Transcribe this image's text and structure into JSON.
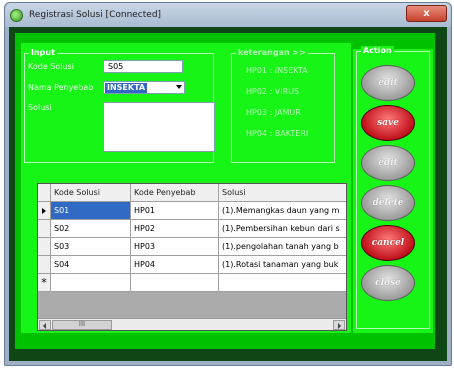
{
  "window": {
    "title": "Registrasi Solusi [Connected]",
    "close_label": "x"
  },
  "input_group": {
    "legend": "Input",
    "kode_solusi_label": "Kode Solusi",
    "kode_solusi_value": "S05",
    "nama_penyebab_label": "Nama Penyebab",
    "nama_penyebab_value": "INSEKTA",
    "solusi_label": "Solusi",
    "solusi_value": ""
  },
  "keterangan": {
    "legend": "keterangan >>",
    "items": [
      "HP01 : INSEKTA",
      "HP02 : VIRUS",
      "HP03 : JAMUR",
      "HP04 : BAKTERI"
    ]
  },
  "action": {
    "legend": "Action",
    "buttons": [
      {
        "label": "edit",
        "color": "grey"
      },
      {
        "label": "save",
        "color": "red"
      },
      {
        "label": "edit",
        "color": "grey"
      },
      {
        "label": "delete",
        "color": "grey"
      },
      {
        "label": "cancel",
        "color": "red"
      },
      {
        "label": "close",
        "color": "grey"
      }
    ]
  },
  "grid": {
    "columns": [
      "Kode Solusi",
      "Kode Penyebab",
      "Solusi"
    ],
    "rows": [
      {
        "kode_solusi": "S01",
        "kode_penyebab": "HP01",
        "solusi": "(1).Memangkas daun yang m"
      },
      {
        "kode_solusi": "S02",
        "kode_penyebab": "HP02",
        "solusi": "(1).Pembersihan kebun dari s"
      },
      {
        "kode_solusi": "S03",
        "kode_penyebab": "HP03",
        "solusi": "(1).pengolahan tanah yang b"
      },
      {
        "kode_solusi": "S04",
        "kode_penyebab": "HP04",
        "solusi": "(1).Rotasi tanaman yang buk"
      }
    ],
    "new_row_marker": "*",
    "scroll_thumb": "III"
  },
  "colors": {
    "panel_green": "#17f517",
    "dark_green": "#0f4616",
    "mid_green": "#00c100",
    "selection_blue": "#316ac5"
  }
}
